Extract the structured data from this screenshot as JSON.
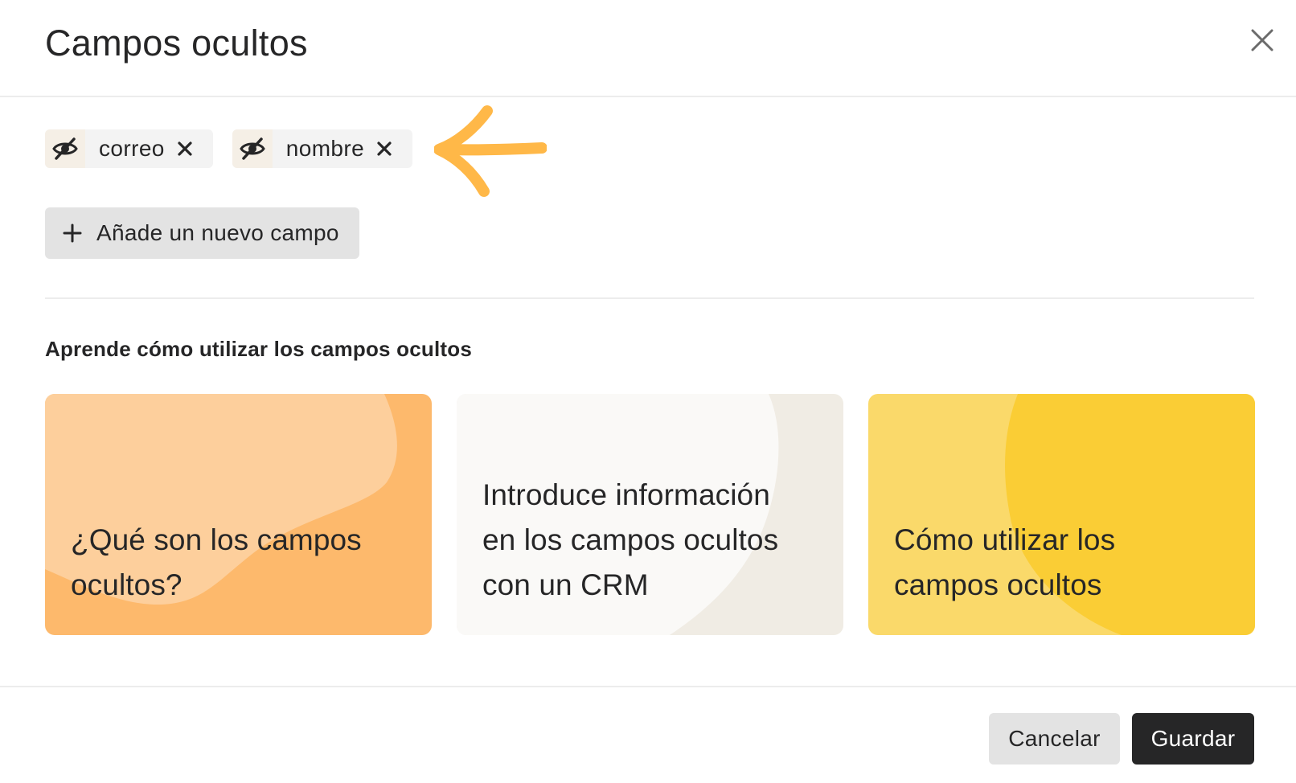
{
  "header": {
    "title": "Campos ocultos",
    "close_icon": "close-icon"
  },
  "hidden_fields": [
    {
      "label": "correo",
      "icon": "eye-slash-icon",
      "remove_icon": "close-icon"
    },
    {
      "label": "nombre",
      "icon": "eye-slash-icon",
      "remove_icon": "close-icon"
    }
  ],
  "add_field": {
    "label": "Añade un nuevo campo",
    "icon": "plus-icon"
  },
  "learn": {
    "title": "Aprende cómo utilizar los campos ocultos",
    "cards": [
      {
        "text": "¿Qué son los campos ocultos?",
        "bg": "#fdcf9c",
        "accent": "#fdb96c"
      },
      {
        "text": "Introduce información en los campos ocultos con un CRM",
        "bg": "#faf9f7",
        "accent": "#f0ece4"
      },
      {
        "text": "Cómo utilizar los campos ocultos",
        "bg": "#fad96a",
        "accent": "#facd35"
      }
    ]
  },
  "footer": {
    "cancel_label": "Cancelar",
    "save_label": "Guardar"
  },
  "colors": {
    "arrow": "#ffb848",
    "primary_button": "#262627",
    "secondary_button": "#e3e3e3"
  }
}
